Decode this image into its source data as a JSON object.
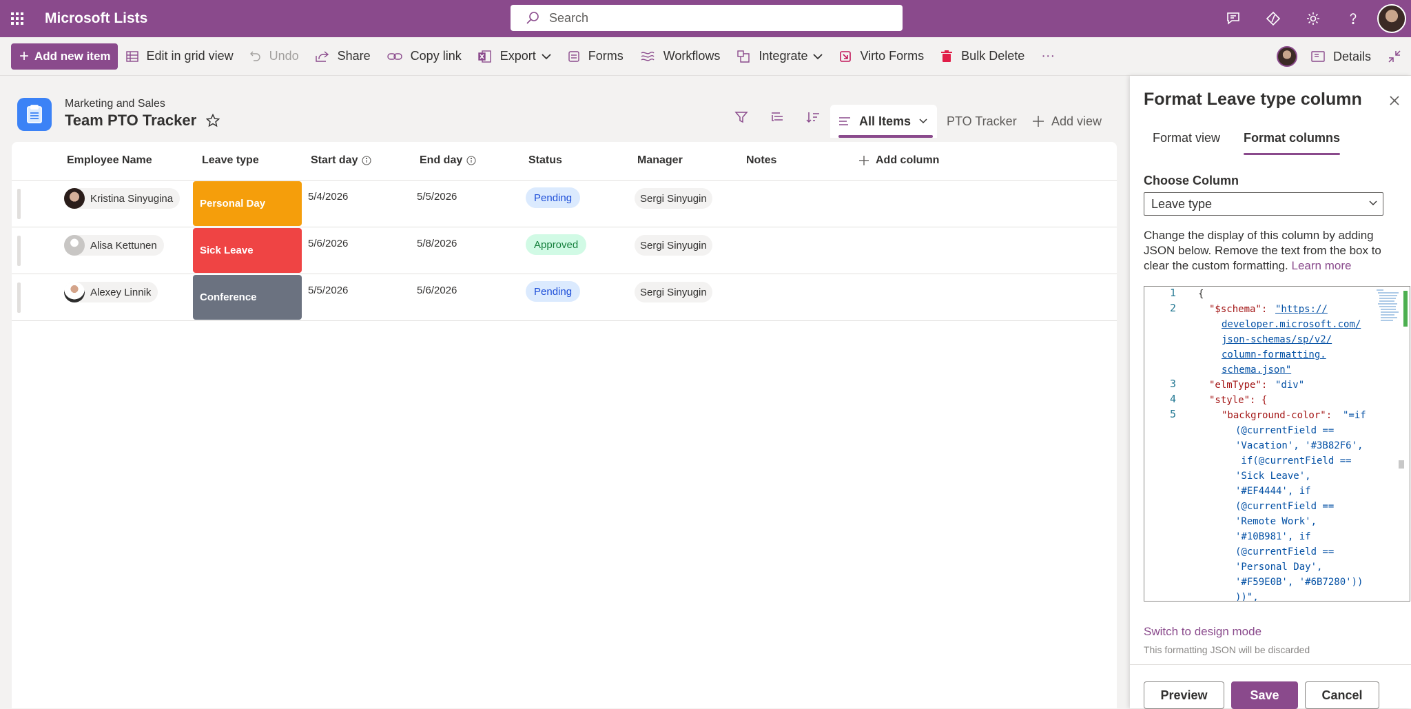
{
  "suitebar": {
    "app_title": "Microsoft Lists",
    "search_placeholder": "Search"
  },
  "commandbar": {
    "add_new_item": "Add new item",
    "edit_grid": "Edit in grid view",
    "undo": "Undo",
    "share": "Share",
    "copy_link": "Copy link",
    "export": "Export",
    "forms": "Forms",
    "workflows": "Workflows",
    "integrate": "Integrate",
    "virto_forms": "Virto Forms",
    "bulk_delete": "Bulk Delete",
    "more": "···",
    "details": "Details"
  },
  "list": {
    "site_name": "Marketing and Sales",
    "title": "Team PTO Tracker",
    "views": {
      "active": "All Items",
      "other": "PTO Tracker",
      "add": "Add view"
    },
    "columns": {
      "employee": "Employee Name",
      "leave_type": "Leave type",
      "start_day": "Start day",
      "end_day": "End day",
      "status": "Status",
      "manager": "Manager",
      "notes": "Notes",
      "add_column": "Add column"
    },
    "rows": [
      {
        "employee": "Kristina Sinyugina",
        "leave_type": "Personal Day",
        "leave_color": "#F59E0B",
        "start": "5/4/2026",
        "end": "5/5/2026",
        "status": "Pending",
        "manager": "Sergi Sinyugin"
      },
      {
        "employee": "Alisa Kettunen",
        "leave_type": "Sick Leave",
        "leave_color": "#EF4444",
        "start": "5/6/2026",
        "end": "5/8/2026",
        "status": "Approved",
        "manager": "Sergi Sinyugin"
      },
      {
        "employee": "Alexey Linnik",
        "leave_type": "Conference",
        "leave_color": "#6B7280",
        "start": "5/5/2026",
        "end": "5/6/2026",
        "status": "Pending",
        "manager": "Sergi Sinyugin"
      }
    ]
  },
  "panel": {
    "title": "Format Leave type column",
    "tab_view": "Format view",
    "tab_columns": "Format columns",
    "choose_column_label": "Choose Column",
    "choose_column_value": "Leave type",
    "description": "Change the display of this column by adding JSON below. Remove the text from the box to clear the custom formatting.",
    "learn_more": "Learn more",
    "editor": {
      "line_numbers": [
        "1",
        "2",
        "3",
        "4",
        "5"
      ],
      "lines": [
        "{",
        "\"$schema\":",
        "\"https://",
        "developer.microsoft.com/",
        "json-schemas/sp/v2/",
        "column-formatting.",
        "schema.json\"",
        "\"elmType\":",
        "\"div\"",
        "\"style\": {",
        "\"background-color\":",
        "\"=if",
        "(@currentField ==",
        "'Vacation', '#3B82F6',",
        " if(@currentField ==",
        "'Sick Leave',",
        "'#EF4444', if",
        "(@currentField ==",
        "'Remote Work',",
        "'#10B981', if",
        "(@currentField ==",
        "'Personal Day',",
        "'#F59E0B', '#6B7280'))",
        "))\","
      ]
    },
    "switch_design": "Switch to design mode",
    "discard_note": "This formatting JSON will be discarded",
    "preview": "Preview",
    "save": "Save",
    "cancel": "Cancel"
  },
  "colors": {
    "brand": "#8a4a8c",
    "pending_bg": "#dbeafe",
    "approved_bg": "#d1fae5"
  }
}
